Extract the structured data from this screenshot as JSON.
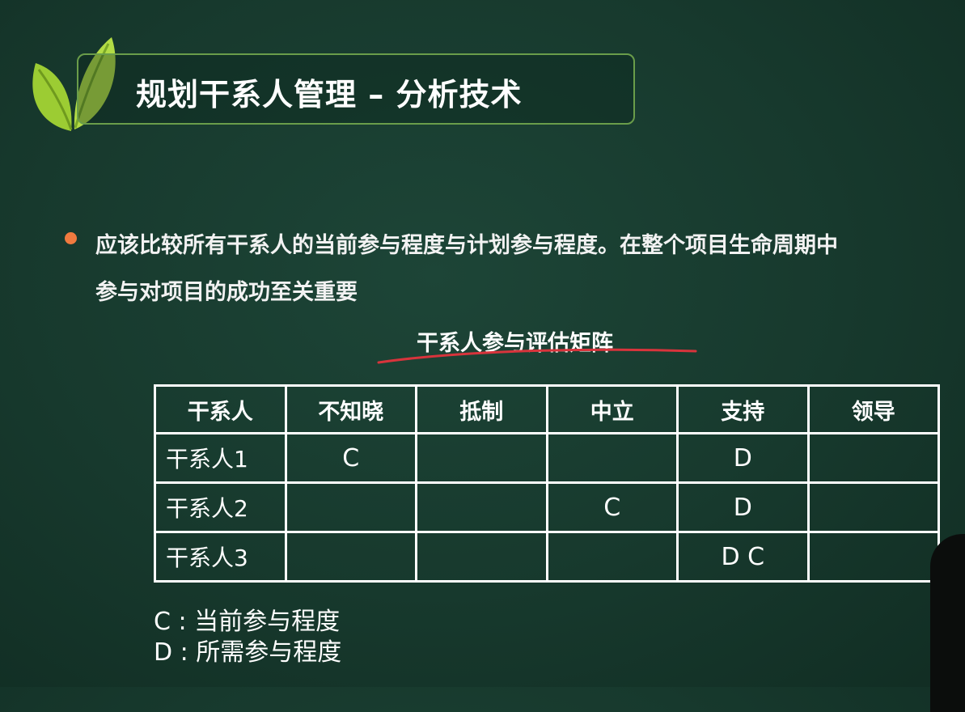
{
  "slide": {
    "title": "规划干系人管理 – 分析技术",
    "bullet": {
      "line1": "应该比较所有干系人的当前参与程度与计划参与程度。在整个项目生命周期中",
      "line2": "参与对项目的成功至关重要"
    },
    "matrix_title": "干系人参与评估矩阵",
    "table": {
      "headers": [
        "干系人",
        "不知晓",
        "抵制",
        "中立",
        "支持",
        "领导"
      ],
      "rows": [
        [
          "干系人1",
          "C",
          "",
          "",
          "D",
          ""
        ],
        [
          "干系人2",
          "",
          "",
          "C",
          "D",
          ""
        ],
        [
          "干系人3",
          "",
          "",
          "",
          "D C",
          ""
        ]
      ]
    },
    "legend": {
      "c": "C : 当前参与程度",
      "d": "D : 所需参与程度"
    }
  },
  "colors": {
    "background": "#17392d",
    "accent_leaf": "#a6d33a",
    "title_border": "#6a9d4a",
    "bullet": "#f07a3f",
    "annotation_red": "#d8343c"
  },
  "icons": {
    "logo": "leaf-icon",
    "bullet": "bullet-dot-icon"
  }
}
